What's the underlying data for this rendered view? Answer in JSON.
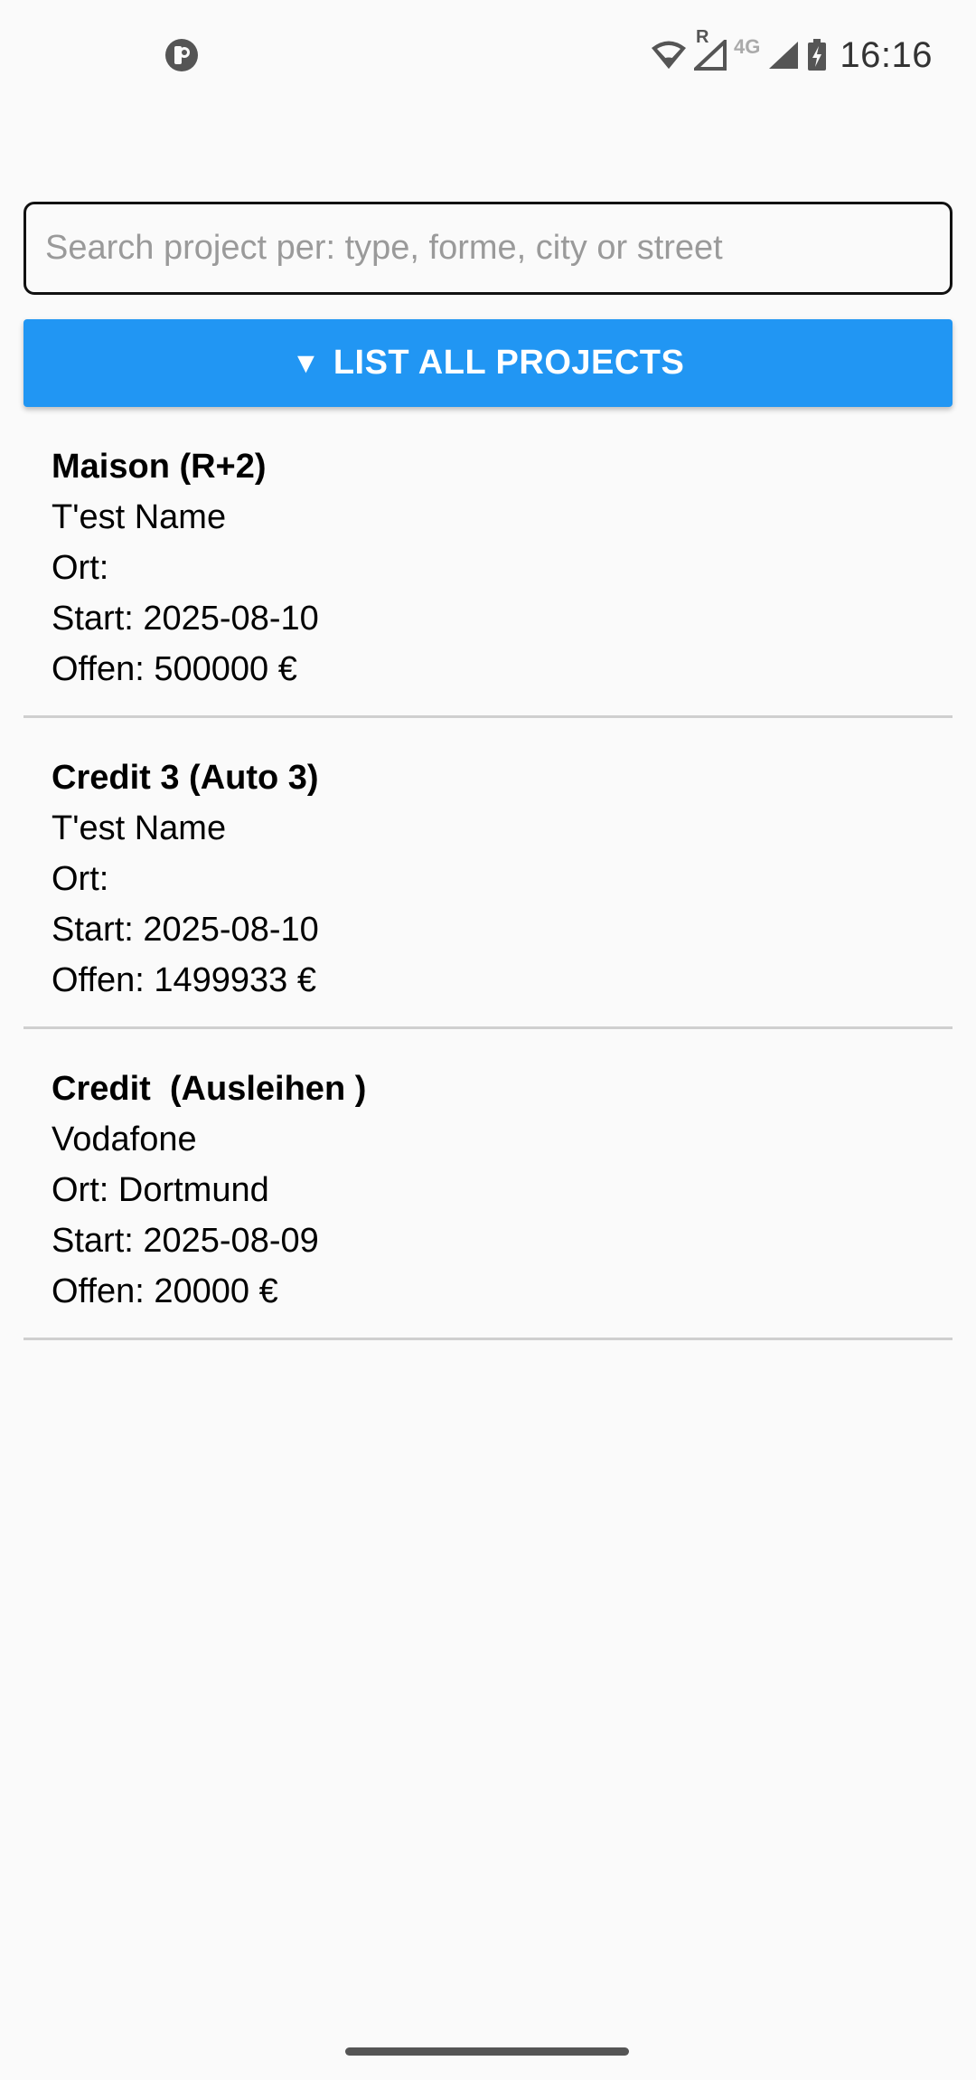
{
  "status_bar": {
    "time": "16:16",
    "network_label": "4G",
    "roaming_label": "R",
    "icons": [
      "app-notification-icon",
      "wifi-icon",
      "signal-roaming-icon",
      "signal-icon",
      "battery-charging-icon"
    ]
  },
  "search": {
    "placeholder": "Search project per: type, forme, city or street",
    "value": ""
  },
  "list_button": {
    "arrow": "▼",
    "label": "LIST ALL PROJECTS",
    "color": "#2196f3"
  },
  "projects": [
    {
      "title": "Maison (R+2)",
      "name": "T'est Name",
      "ort": "Ort: ",
      "start": "Start: 2025-08-10",
      "offen": "Offen: 500000 €"
    },
    {
      "title": "Credit 3 (Auto 3)",
      "name": "T'est Name",
      "ort": "Ort: ",
      "start": "Start: 2025-08-10",
      "offen": "Offen: 1499933 €"
    },
    {
      "title": "Credit  (Ausleihen )",
      "name": "Vodafone",
      "ort": "Ort: Dortmund",
      "start": "Start: 2025-08-09",
      "offen": "Offen: 20000 €"
    }
  ]
}
